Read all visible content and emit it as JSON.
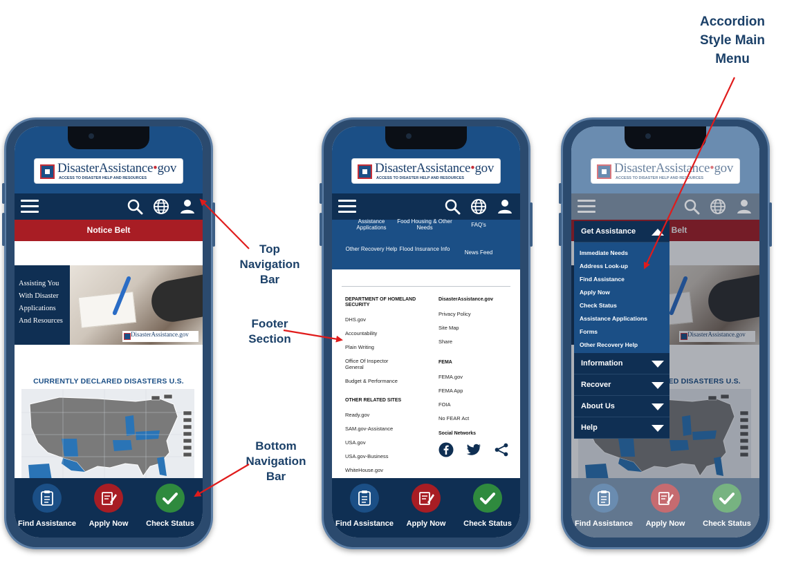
{
  "brand": {
    "name_main": "DisasterAssistance",
    "name_dot": "•",
    "name_tld": "gov",
    "tagline": "ACCESS TO DISASTER HELP AND RESOURCES",
    "small_name": "DisasterAssistance.gov"
  },
  "icons": {
    "menu": "hamburger-menu-icon",
    "search": "search-icon",
    "language": "globe-icon",
    "account": "user-icon"
  },
  "colors": {
    "header_blue": "#1b4f86",
    "nav_navy": "#0f2f53",
    "notice_red": "#a81d24",
    "find_circle": "#1b4f86",
    "apply_circle": "#a81d24",
    "status_circle": "#2f8a3e",
    "annotation_text": "#1b4068",
    "annotation_arrow": "#e01b1b"
  },
  "home": {
    "notice_belt": "Notice Belt",
    "hero_lines": [
      "Assisting You",
      "With Disaster",
      "Applications",
      "And Resources"
    ],
    "disasters_title": "CURRENTLY DECLARED DISASTERS U.S."
  },
  "bottom_nav": [
    {
      "label": "Find Assistance",
      "icon": "clipboard-icon"
    },
    {
      "label": "Apply Now",
      "icon": "form-pen-icon"
    },
    {
      "label": "Check Status",
      "icon": "checkmark-icon"
    }
  ],
  "footer_screen": {
    "quick_links": [
      "Assistance Applications",
      "Food Housing & Other Needs",
      "FAQ's",
      "Other Recovery Help",
      "Flood Insurance Info",
      "News Feed"
    ],
    "dhs_heading": "DEPARTMENT OF HOMELAND SECURITY",
    "dhs_links": [
      "DHS.gov",
      "Accountability",
      "Plain Writing",
      "Office Of Inspector General",
      "Budget & Performance"
    ],
    "related_heading": "OTHER RELATED SITES",
    "related_links": [
      "Ready.gov",
      "SAM.gov-Assistance",
      "USA.gov",
      "USA.gov-Business",
      "WhiteHouse.gov"
    ],
    "da_heading": "DisasterAssistance.gov",
    "da_links": [
      "Privacy Policy",
      "Site Map",
      "Share"
    ],
    "fema_heading": "FEMA",
    "fema_links": [
      "FEMA.gov",
      "FEMA App",
      "FOIA",
      "No FEAR Act"
    ],
    "social_heading": "Social Networks",
    "social_icons": [
      "facebook-icon",
      "twitter-icon",
      "share-icon"
    ]
  },
  "menu_screen": {
    "sections": [
      {
        "label": "Get Assistance",
        "expanded": true
      },
      {
        "label": "Information",
        "expanded": false
      },
      {
        "label": "Recover",
        "expanded": false
      },
      {
        "label": "About Us",
        "expanded": false
      },
      {
        "label": "Help",
        "expanded": false
      }
    ],
    "get_assistance_items": [
      "Immediate Needs",
      "Address Look-up",
      "Find Assistance",
      "Apply Now",
      "Check Status",
      "Assistance Applications",
      "Forms",
      "Other Recovery Help"
    ]
  },
  "callouts": {
    "top_nav": [
      "Top",
      "Navigation",
      "Bar"
    ],
    "footer": [
      "Footer",
      "Section"
    ],
    "bottom_nav": [
      "Bottom",
      "Navigation",
      "Bar"
    ],
    "accordion": [
      "Accordion",
      "Style Main",
      "Menu"
    ]
  }
}
